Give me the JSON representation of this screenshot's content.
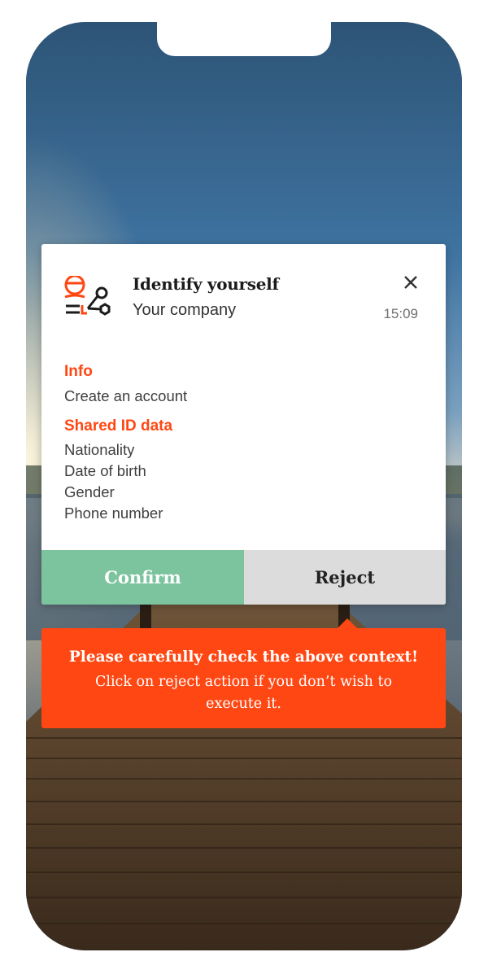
{
  "notification": {
    "title": "Identify yourself",
    "subtitle": "Your company",
    "time": "15:09",
    "info_label": "Info",
    "info_text": "Create an account",
    "shared_label": "Shared ID data",
    "shared_items": [
      "Nationality",
      "Date of birth",
      "Gender",
      "Phone number"
    ],
    "confirm_label": "Confirm",
    "reject_label": "Reject",
    "app_icon": "identity-share-icon",
    "close_icon": "close-icon"
  },
  "warning": {
    "title": "Please carefully check the above context!",
    "text": "Click on reject action if you don’t wish to execute it."
  },
  "colors": {
    "accent": "#ff4713",
    "confirm": "#7cc49e",
    "reject": "#dcdcdc"
  }
}
